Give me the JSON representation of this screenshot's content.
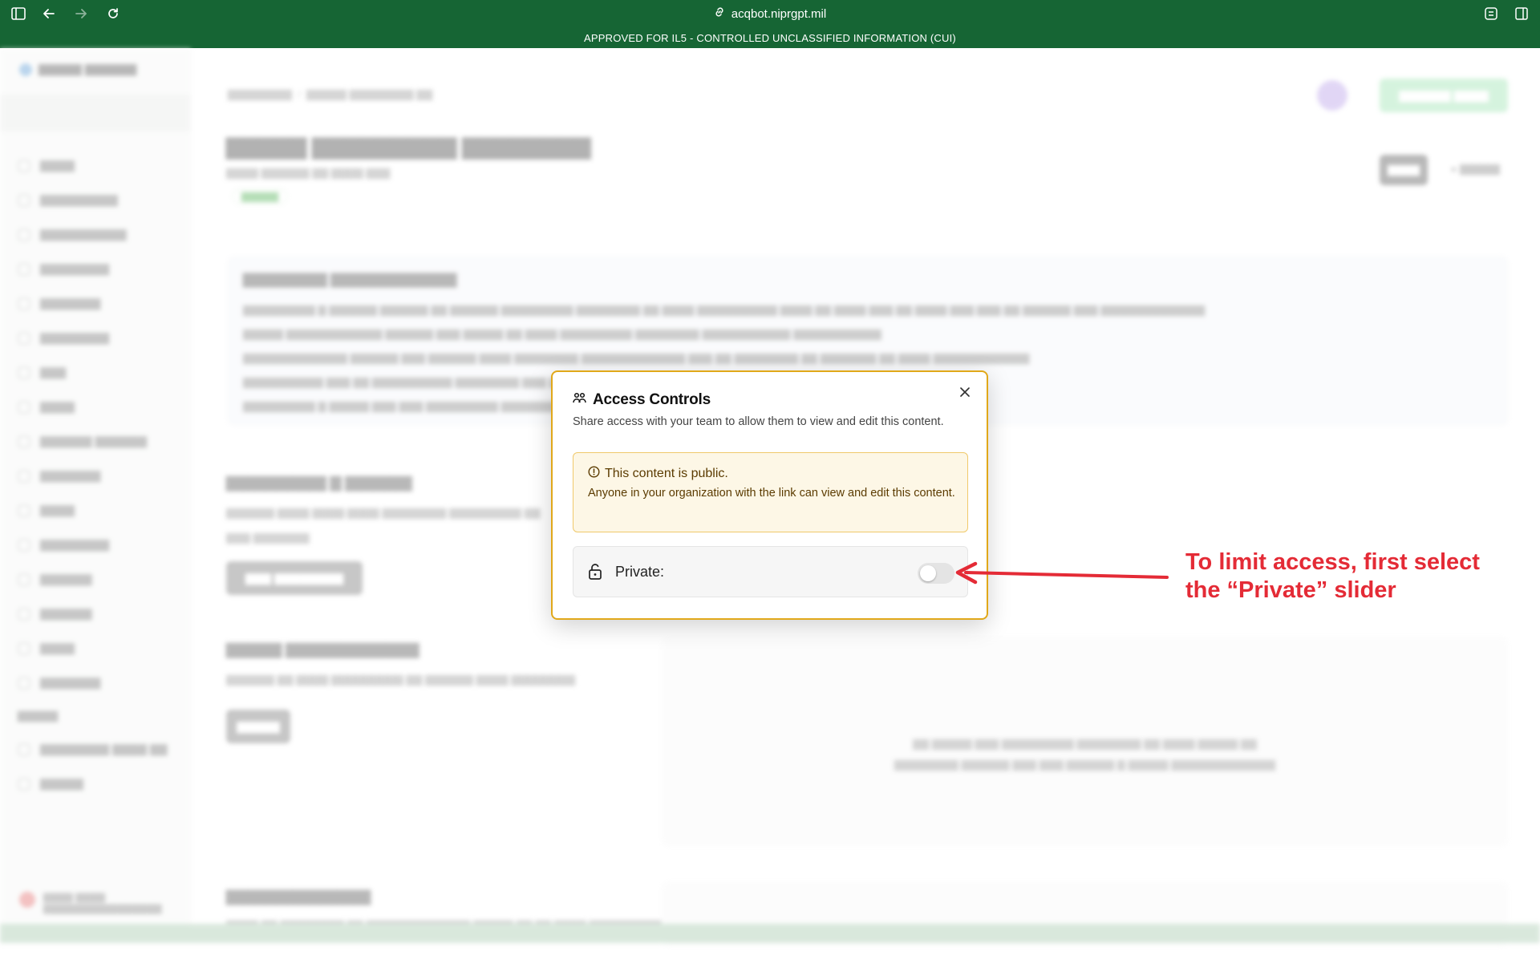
{
  "browser": {
    "url": "acqbot.niprgpt.mil",
    "banner": "APPROVED FOR IL5 - CONTROLLED UNCLASSIFIED INFORMATION (CUI)"
  },
  "modal": {
    "title": "Access Controls",
    "description": "Share access with your team to allow them to view and edit this content.",
    "alert_title": "This content is public.",
    "alert_text": "Anyone in your organization with the link can view and edit this content.",
    "private_label": "Private:",
    "private_enabled": false
  },
  "annotation": {
    "line1": "To limit access, first select",
    "line2": "the “Private” slider",
    "color": "#e42b36"
  },
  "colors": {
    "brand_green": "#166534",
    "modal_border": "#e1a81a"
  }
}
